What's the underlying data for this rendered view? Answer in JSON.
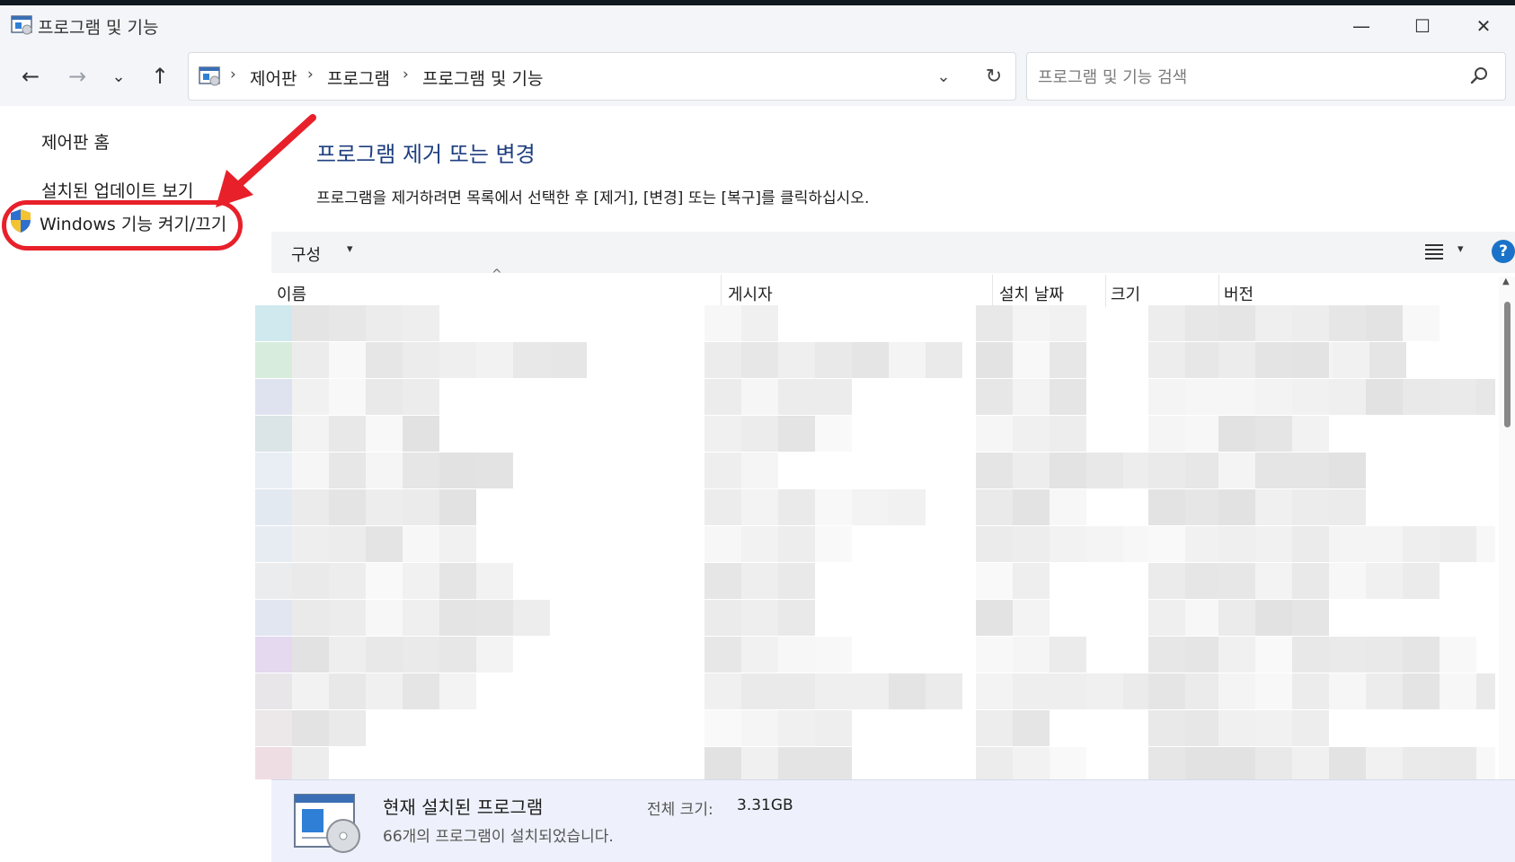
{
  "window": {
    "title": "프로그램 및 기능",
    "minimize": "—",
    "maximize": "☐",
    "close": "✕"
  },
  "nav": {
    "back": "←",
    "forward": "→",
    "recent": "⌄",
    "up": "↑"
  },
  "address": {
    "crumbs": [
      "제어판",
      "프로그램",
      "프로그램 및 기능"
    ],
    "separator": "›",
    "dropdown": "⌄",
    "refresh": "↻"
  },
  "search": {
    "placeholder": "프로그램 및 기능 검색"
  },
  "sidebar": {
    "home": "제어판 홈",
    "updates": "설치된 업데이트 보기",
    "features": "Windows 기능 켜기/끄기"
  },
  "main": {
    "title": "프로그램 제거 또는 변경",
    "description": "프로그램을 제거하려면 목록에서 선택한 후 [제거], [변경] 또는 [복구]를 클릭하십시오."
  },
  "toolbar": {
    "organize": "구성",
    "caret": "▾",
    "help": "?"
  },
  "columns": [
    "이름",
    "게시자",
    "설치 날짜",
    "크기",
    "버전"
  ],
  "sort_indicator": "^",
  "status": {
    "title": "현재 설치된 프로그램",
    "size_label": "전체 크기:",
    "size_value": "3.31GB",
    "count": "66개의 프로그램이 설치되었습니다."
  },
  "colors": {
    "accent_title": "#1d3e7f",
    "annotation_red": "#e8202a",
    "help_blue": "#1a73c8"
  }
}
